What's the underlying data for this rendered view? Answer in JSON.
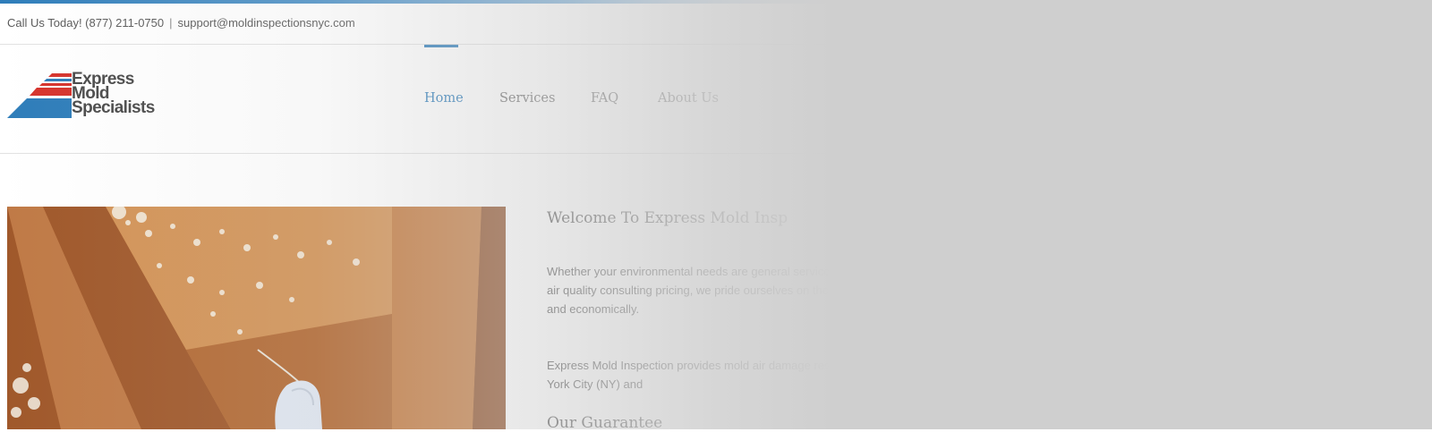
{
  "topbar": {
    "phone_text": "Call Us Today! (877) 211-0750",
    "separator": "|",
    "email_text": "support@moldinspectionsnyc.com"
  },
  "logo": {
    "line1": "Express",
    "line2": "Mold",
    "line3": "Specialists",
    "colors": {
      "red": "#d6332c",
      "blue": "#2e7dba",
      "text": "#4a4a4a"
    }
  },
  "nav": {
    "items": [
      {
        "label": "Home",
        "active": true
      },
      {
        "label": "Services",
        "active": false
      },
      {
        "label": "FAQ",
        "active": false
      },
      {
        "label": "About Us",
        "active": false
      }
    ]
  },
  "main": {
    "welcome_title": "Welcome To Express Mold Insp",
    "paragraph1": "Whether your environmental needs are general service mold and indoor air quality consulting pricing, we pride ourselves on the ability to quickly and economically.",
    "paragraph2": "Express Mold Inspection provides mold air damage restoration in New York City (NY) and",
    "guarantee_title": "Our Guarantee"
  },
  "colors": {
    "accent": "#2e7dba",
    "overlay": "#cfcfcf"
  }
}
